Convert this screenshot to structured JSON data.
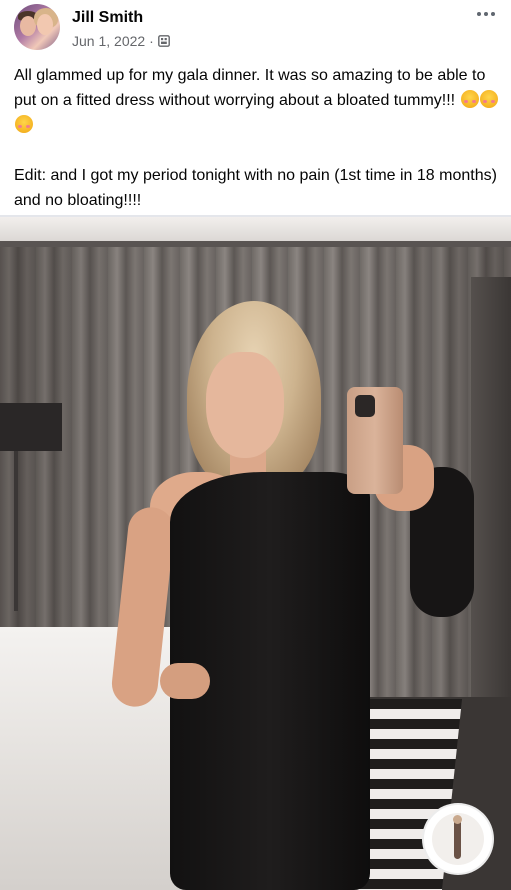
{
  "post": {
    "author": "Jill Smith",
    "date": "Jun 1, 2022",
    "separator": "·",
    "audience_icon": "audience-icon",
    "more_icon": "more-options-icon",
    "text_line1": "All glammed up for my gala dinner. It was so amazing to be able to put on a fitted dress without worrying about a bloated tummy!!!",
    "emoji_name": "smiling-face-with-hearts",
    "emoji_count": 3,
    "text_line2": "Edit: and I got my period tonight with no pain (1st time in 18 months) and no bloating!!!!"
  },
  "colors": {
    "name": "#050505",
    "meta": "#65676b",
    "divider": "#e4e6eb"
  }
}
